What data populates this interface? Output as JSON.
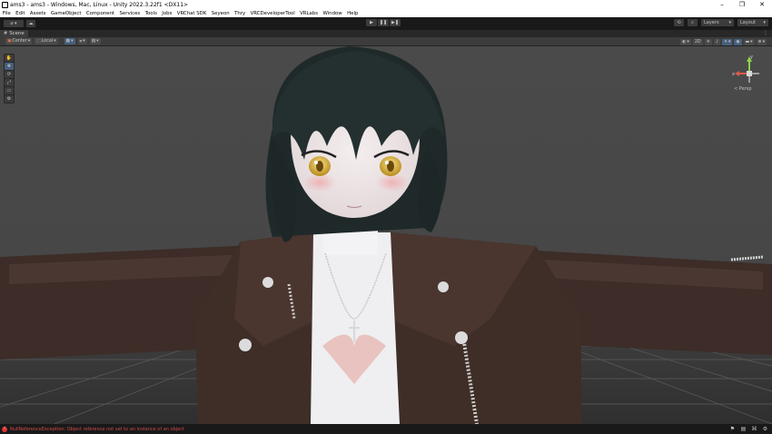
{
  "window": {
    "title": "ams3 - ams3 - Windows, Mac, Linux - Unity 2022.3.22f1 <DX11>",
    "controls": [
      "–",
      "❐",
      "✕"
    ]
  },
  "menu": [
    "File",
    "Edit",
    "Assets",
    "GameObject",
    "Component",
    "Services",
    "Tools",
    "Jobs",
    "VRChat SDK",
    "Seyeon",
    "Thry",
    "VRCDeveloperTool",
    "VRLabs",
    "Window",
    "Help"
  ],
  "toolbar": {
    "account_label": "⌀ ▾",
    "cloud_label": "☁",
    "play_label": "▶",
    "pause_label": "❚❚",
    "step_label": "▶❚",
    "history_icon": "⟲",
    "search_icon": "⌕",
    "layers_label": "Layers",
    "layout_label": "Layout"
  },
  "scene_tab": {
    "label": "Scene",
    "menu": "⋮"
  },
  "scene_toolbar": {
    "pivot_label": "Center",
    "space_label": "Local"
  },
  "viewport": {
    "persp_label": "< Persp",
    "gizmo_axes": {
      "y": "y",
      "x": "x"
    }
  },
  "tools": [
    "✋",
    "✥",
    "⟳",
    "⤢",
    "▭",
    "⚙"
  ],
  "status": {
    "error_text": "NullReferenceException: Object reference not set to an instance of an object"
  },
  "colors": {
    "background": "#474747",
    "accent": "#46607c",
    "error": "#d14a4a"
  }
}
